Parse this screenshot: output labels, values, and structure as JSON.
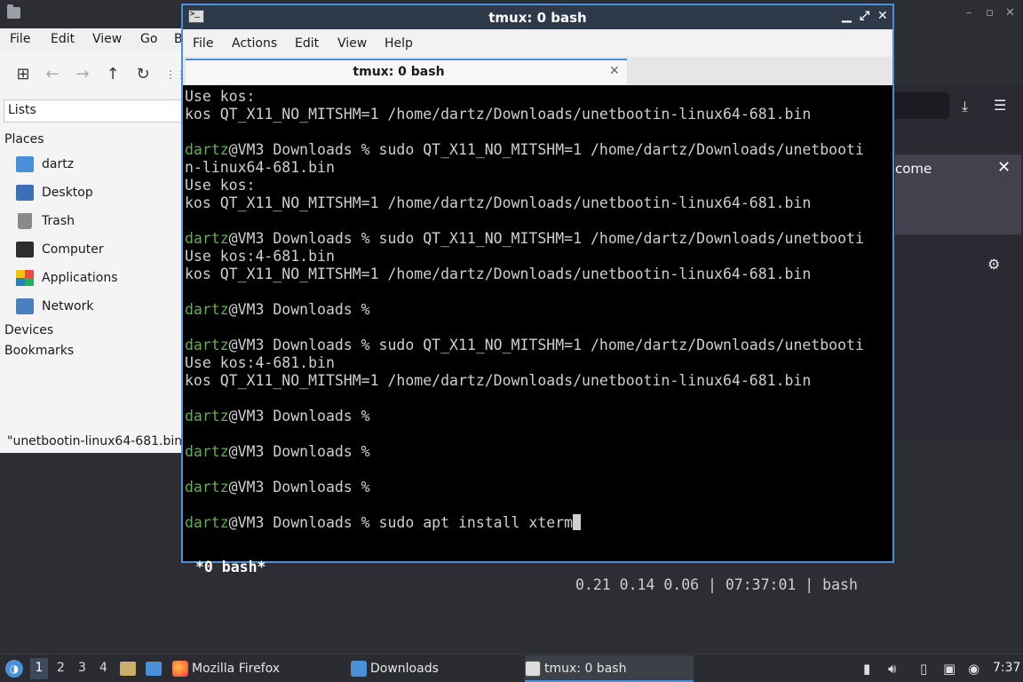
{
  "desktop_top": {
    "right_controls": [
      "–",
      "▫",
      "✕"
    ]
  },
  "file_manager": {
    "menu": [
      "File",
      "Edit",
      "View",
      "Go",
      "B"
    ],
    "lists_label": "Lists",
    "places_header": "Places",
    "places": [
      "dartz",
      "Desktop",
      "Trash",
      "Computer",
      "Applications",
      "Network"
    ],
    "devices_header": "Devices",
    "bookmarks_header": "Bookmarks",
    "status": "\"unetbootin-linux64-681.bin\""
  },
  "firefox_bg": {
    "panel_text": "come"
  },
  "terminal": {
    "title": "tmux: 0 bash",
    "menu": [
      "File",
      "Actions",
      "Edit",
      "View",
      "Help"
    ],
    "tab_label": "tmux: 0 bash",
    "lines": [
      {
        "user": "",
        "text": "Use kos:"
      },
      {
        "user": "",
        "text": "kos QT_X11_NO_MITSHM=1 /home/dartz/Downloads/unetbootin-linux64-681.bin"
      },
      {
        "user": "",
        "text": ""
      },
      {
        "user": "dartz",
        "text": "@VM3 Downloads % sudo QT_X11_NO_MITSHM=1 /home/dartz/Downloads/unetbooti"
      },
      {
        "user": "",
        "text": "n-linux64-681.bin"
      },
      {
        "user": "",
        "text": "Use kos:"
      },
      {
        "user": "",
        "text": "kos QT_X11_NO_MITSHM=1 /home/dartz/Downloads/unetbootin-linux64-681.bin"
      },
      {
        "user": "",
        "text": ""
      },
      {
        "user": "dartz",
        "text": "@VM3 Downloads % sudo QT_X11_NO_MITSHM=1 /home/dartz/Downloads/unetbooti"
      },
      {
        "user": "",
        "text": "Use kos:4-681.bin"
      },
      {
        "user": "",
        "text": "kos QT_X11_NO_MITSHM=1 /home/dartz/Downloads/unetbootin-linux64-681.bin"
      },
      {
        "user": "",
        "text": ""
      },
      {
        "user": "dartz",
        "text": "@VM3 Downloads %"
      },
      {
        "user": "",
        "text": ""
      },
      {
        "user": "dartz",
        "text": "@VM3 Downloads % sudo QT_X11_NO_MITSHM=1 /home/dartz/Downloads/unetbooti"
      },
      {
        "user": "",
        "text": "Use kos:4-681.bin"
      },
      {
        "user": "",
        "text": "kos QT_X11_NO_MITSHM=1 /home/dartz/Downloads/unetbootin-linux64-681.bin"
      },
      {
        "user": "",
        "text": ""
      },
      {
        "user": "dartz",
        "text": "@VM3 Downloads %"
      },
      {
        "user": "",
        "text": ""
      },
      {
        "user": "dartz",
        "text": "@VM3 Downloads %"
      },
      {
        "user": "",
        "text": ""
      },
      {
        "user": "dartz",
        "text": "@VM3 Downloads %"
      },
      {
        "user": "",
        "text": ""
      },
      {
        "user": "dartz",
        "text": "@VM3 Downloads % sudo apt install xterm",
        "cursor": true
      }
    ],
    "status_left": "*0 bash*",
    "status_right": "0.21 0.14 0.06 | 07:37:01 | bash",
    "user_color": "#5fb346",
    "border_color": "#4a90d9"
  },
  "taskbar": {
    "workspaces": [
      "1",
      "2",
      "3",
      "4"
    ],
    "tasks": [
      {
        "label": "Mozilla Firefox",
        "icon": "firefox-icon"
      },
      {
        "label": "Downloads",
        "icon": "folder-icon"
      },
      {
        "label": "tmux: 0 bash",
        "icon": "terminal-icon"
      }
    ],
    "clock": "7:37"
  }
}
